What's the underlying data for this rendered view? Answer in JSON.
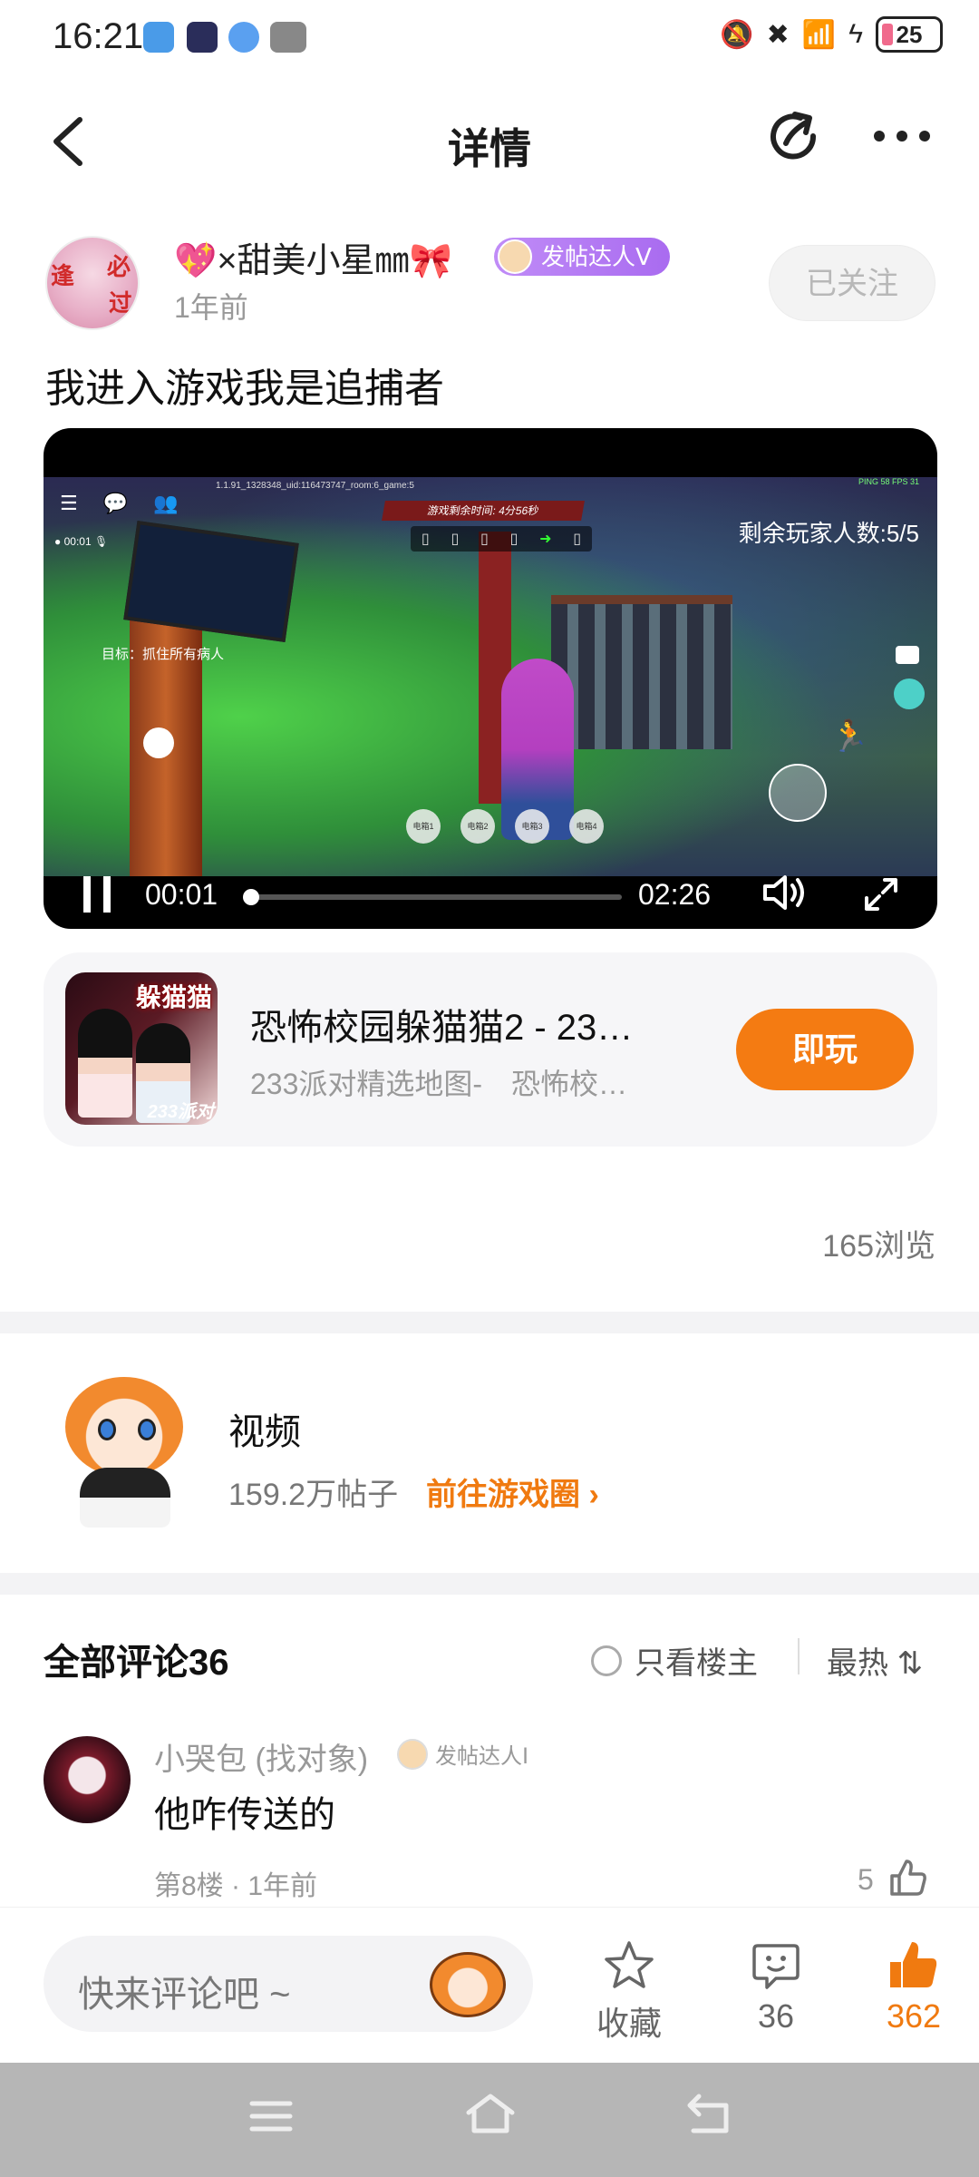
{
  "status": {
    "time": "16:21",
    "battery": "25",
    "colors": {
      "app1": "#4a9be8",
      "app2": "#2a2d5a",
      "app3": "#5aa0f0",
      "app4": "#888888"
    }
  },
  "header": {
    "title": "详情",
    "icons": {
      "back": "chevron-left-icon",
      "share": "share-icon",
      "more": "more-icon"
    }
  },
  "post": {
    "author_name": "💖×甜美小星㎜🎀",
    "author_badge": "发帖达人Ⅴ",
    "author_time": "1年前",
    "follow_label": "已关注",
    "title": "我进入游戏我是追捕者",
    "views": "165浏览"
  },
  "video": {
    "hud_top": "1.1.91_1328348_uid:116473747_room:6_game:5",
    "hud_right": "PING 58 FPS 31",
    "timer": "游戏剩余时间: 4分56秒",
    "players_left": "剩余玩家人数:5/5",
    "goal": "目标：抓住所有病人",
    "rec_time": "00:01",
    "elec": [
      "电箱1",
      "电箱2",
      "电箱3",
      "电箱4"
    ],
    "current_time": "00:01",
    "total_time": "02:26",
    "progress": 0.0
  },
  "game": {
    "icon_title": "躲猫猫",
    "icon_sub": "233派对",
    "name": "恐怖校园躲猫猫2 - 23…",
    "desc": "233派对精选地图-　恐怖校…",
    "play_label": "即玩",
    "accent": "#f47b12"
  },
  "circle": {
    "name": "视频",
    "stats": "159.2万帖子",
    "link_label": "前往游戏圈 ›"
  },
  "comments": {
    "title": "全部评论36",
    "only_op_label": "只看楼主",
    "sort_label": "最热 ⇅",
    "items": [
      {
        "name": "小哭包 (找对象)",
        "badge": "发帖达人Ⅰ",
        "text": "他咋传送的",
        "meta": "第8楼 · 1年前",
        "likes": "5"
      }
    ]
  },
  "bottom": {
    "input_placeholder": "快来评论吧 ~",
    "collect_label": "收藏",
    "comment_count": "36",
    "like_count": "362"
  }
}
